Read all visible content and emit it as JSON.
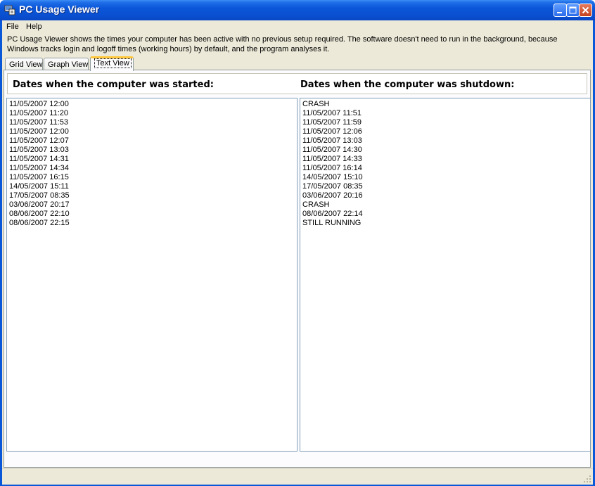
{
  "window": {
    "title": "PC Usage Viewer",
    "icons": {
      "app": "app-icon",
      "minimize": "minimize-icon",
      "maximize": "maximize-icon",
      "close": "close-icon"
    }
  },
  "menu": {
    "items": [
      "File",
      "Help"
    ]
  },
  "description": "PC Usage Viewer shows the times your computer has been active with no previous setup required. The software doesn't need to run in the background, because Windows tracks login and logoff times (working hours) by default, and the program analyses it.",
  "tabs": [
    {
      "label": "Grid View",
      "active": false
    },
    {
      "label": "Graph View",
      "active": false
    },
    {
      "label": "Text View",
      "active": true
    }
  ],
  "text_view": {
    "started_header": "Dates when the computer was started:",
    "shutdown_header": "Dates when the computer was shutdown:",
    "started": [
      "11/05/2007 12:00",
      "11/05/2007 11:20",
      "11/05/2007 11:53",
      "11/05/2007 12:00",
      "11/05/2007 12:07",
      "11/05/2007 13:03",
      "11/05/2007 14:31",
      "11/05/2007 14:34",
      "11/05/2007 16:15",
      "14/05/2007 15:11",
      "17/05/2007 08:35",
      "03/06/2007 20:17",
      "08/06/2007 22:10",
      "08/06/2007 22:15"
    ],
    "shutdown": [
      "CRASH",
      "11/05/2007 11:51",
      "11/05/2007 11:59",
      "11/05/2007 12:06",
      "11/05/2007 13:03",
      "11/05/2007 14:30",
      "11/05/2007 14:33",
      "11/05/2007 16:14",
      "14/05/2007 15:10",
      "17/05/2007 08:35",
      "03/06/2007 20:16",
      "CRASH",
      "08/06/2007 22:14",
      "STILL RUNNING"
    ]
  },
  "colors": {
    "titlebar": "#0a57d8",
    "active_tab_accent": "#ffc83c",
    "face": "#ece9d8"
  }
}
